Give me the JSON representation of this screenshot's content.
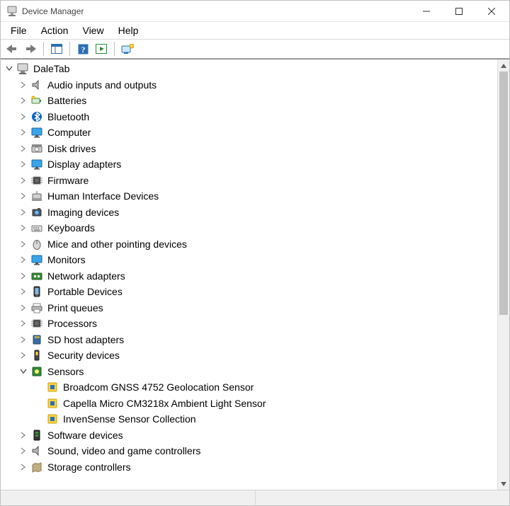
{
  "window": {
    "title": "Device Manager"
  },
  "menu": {
    "file": "File",
    "action": "Action",
    "view": "View",
    "help": "Help"
  },
  "tree": {
    "root": "DaleTab",
    "nodes": [
      {
        "id": "audio",
        "label": "Audio inputs and outputs",
        "expanded": false
      },
      {
        "id": "batteries",
        "label": "Batteries",
        "expanded": false
      },
      {
        "id": "bluetooth",
        "label": "Bluetooth",
        "expanded": false
      },
      {
        "id": "computer",
        "label": "Computer",
        "expanded": false
      },
      {
        "id": "disk",
        "label": "Disk drives",
        "expanded": false
      },
      {
        "id": "display",
        "label": "Display adapters",
        "expanded": false
      },
      {
        "id": "firmware",
        "label": "Firmware",
        "expanded": false
      },
      {
        "id": "hid",
        "label": "Human Interface Devices",
        "expanded": false
      },
      {
        "id": "imaging",
        "label": "Imaging devices",
        "expanded": false
      },
      {
        "id": "keyboards",
        "label": "Keyboards",
        "expanded": false
      },
      {
        "id": "mice",
        "label": "Mice and other pointing devices",
        "expanded": false
      },
      {
        "id": "monitors",
        "label": "Monitors",
        "expanded": false
      },
      {
        "id": "network",
        "label": "Network adapters",
        "expanded": false
      },
      {
        "id": "portable",
        "label": "Portable Devices",
        "expanded": false
      },
      {
        "id": "print",
        "label": "Print queues",
        "expanded": false
      },
      {
        "id": "processors",
        "label": "Processors",
        "expanded": false
      },
      {
        "id": "sdhost",
        "label": "SD host adapters",
        "expanded": false
      },
      {
        "id": "security",
        "label": "Security devices",
        "expanded": false
      },
      {
        "id": "sensors",
        "label": "Sensors",
        "expanded": true,
        "children": [
          {
            "label": "Broadcom GNSS 4752 Geolocation Sensor"
          },
          {
            "label": "Capella Micro CM3218x Ambient Light Sensor"
          },
          {
            "label": "InvenSense Sensor Collection"
          }
        ]
      },
      {
        "id": "software",
        "label": "Software devices",
        "expanded": false
      },
      {
        "id": "sound",
        "label": "Sound, video and game controllers",
        "expanded": false
      },
      {
        "id": "storage",
        "label": "Storage controllers",
        "expanded": false
      }
    ]
  }
}
